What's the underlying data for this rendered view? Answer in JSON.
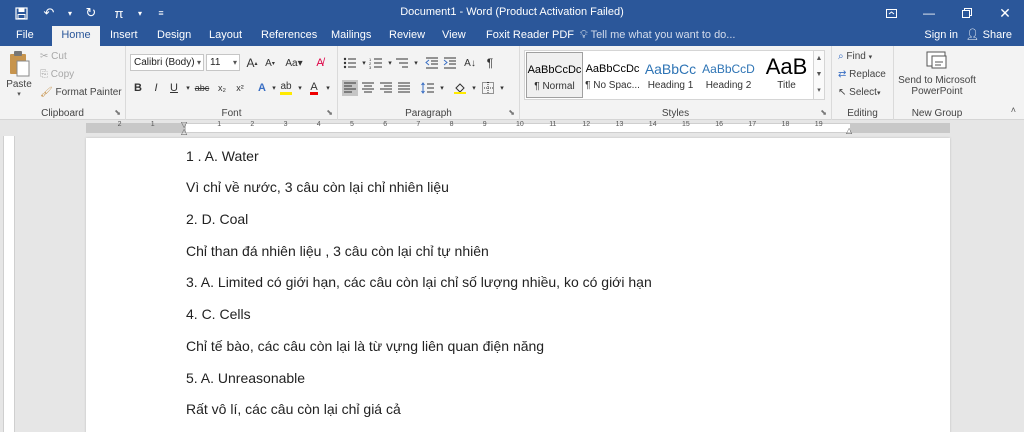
{
  "titlebar": {
    "title": "Document1 - Word (Product Activation Failed)"
  },
  "tabs": [
    "File",
    "Home",
    "Insert",
    "Design",
    "Layout",
    "References",
    "Mailings",
    "Review",
    "View",
    "Foxit Reader PDF"
  ],
  "tell_me": "Tell me what you want to do...",
  "sign_in": "Sign in",
  "share": "Share",
  "clipboard": {
    "paste": "Paste",
    "cut": "Cut",
    "copy": "Copy",
    "format_painter": "Format Painter",
    "label": "Clipboard"
  },
  "font": {
    "name": "Calibri (Body)",
    "size": "11",
    "label": "Font"
  },
  "paragraph": {
    "label": "Paragraph"
  },
  "styles": {
    "label": "Styles",
    "items": [
      {
        "preview": "AaBbCcDc",
        "name": "¶ Normal"
      },
      {
        "preview": "AaBbCcDc",
        "name": "¶ No Spac..."
      },
      {
        "preview": "AaBbCc",
        "name": "Heading 1"
      },
      {
        "preview": "AaBbCcD",
        "name": "Heading 2"
      },
      {
        "preview": "AaB",
        "name": "Title"
      }
    ]
  },
  "editing": {
    "find": "Find",
    "replace": "Replace",
    "select": "Select",
    "label": "Editing"
  },
  "newgroup": {
    "send_line1": "Send to Microsoft",
    "send_line2": "PowerPoint",
    "label": "New Group"
  },
  "ruler_numbers": [
    "2",
    "1",
    "1",
    "2",
    "3",
    "4",
    "5",
    "6",
    "7",
    "8",
    "9",
    "10",
    "11",
    "12",
    "13",
    "14",
    "15",
    "16",
    "17",
    "18",
    "19"
  ],
  "document": {
    "paragraphs": [
      "1 . A. Water",
      " Vì chỉ về nước, 3 câu còn lại chỉ nhiên liệu",
      "2. D. Coal",
      "Chỉ than đá  nhiên liệu , 3 câu còn lại chỉ tự nhiên",
      "3. A. Limited có giới hạn, các câu còn lại chỉ số lượng nhiều, ko có giới hạn",
      "4. C. Cells",
      "Chỉ tế bào, các câu còn lại là từ vựng liên quan điện năng",
      "5. A. Unreasonable",
      "Rất vô lí, các câu còn lại chỉ giá cả"
    ]
  }
}
